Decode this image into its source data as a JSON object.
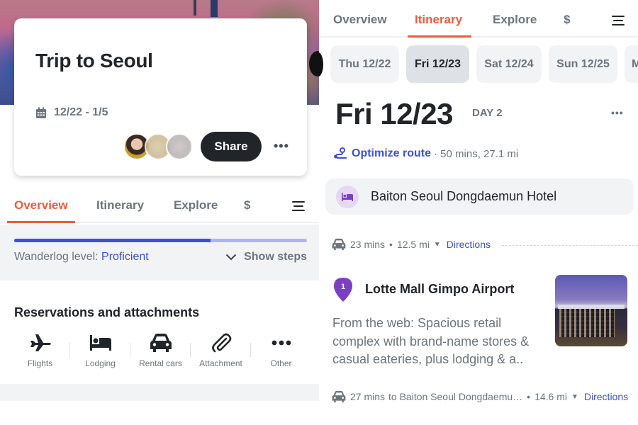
{
  "colors": {
    "accent": "#f05a3c",
    "link": "#3d4fd6",
    "lodging_purple": "#7b3fc4",
    "dark": "#212529",
    "muted": "#6c757d"
  },
  "overview": {
    "trip": {
      "title": "Trip to Seoul",
      "dates": "12/22 - 1/5",
      "calendar_icon": "calendar-icon",
      "avatars": [
        "avatar-1",
        "avatar-2",
        "avatar-3"
      ],
      "share_label": "Share",
      "more_label": "•••"
    },
    "tabs": [
      {
        "label": "Overview",
        "active": true
      },
      {
        "label": "Itinerary",
        "active": false
      },
      {
        "label": "Explore",
        "active": false
      },
      {
        "label": "$",
        "active": false
      }
    ],
    "menu_icon": "hamburger-icon",
    "level": {
      "progress_percent": 67,
      "label": "Wanderlog level: ",
      "value": "Proficient",
      "show_steps_label": "Show steps"
    },
    "reservations": {
      "title": "Reservations and attachments",
      "items": [
        {
          "label": "Flights",
          "icon": "airplane-icon"
        },
        {
          "label": "Lodging",
          "icon": "bed-icon"
        },
        {
          "label": "Rental cars",
          "icon": "car-icon"
        },
        {
          "label": "Attachment",
          "icon": "paperclip-icon"
        },
        {
          "label": "Other",
          "icon": "more-icon"
        }
      ]
    }
  },
  "itinerary": {
    "tabs": [
      {
        "label": "Overview",
        "active": false
      },
      {
        "label": "Itinerary",
        "active": true
      },
      {
        "label": "Explore",
        "active": false
      },
      {
        "label": "$",
        "active": false
      }
    ],
    "day_chips": [
      {
        "label": "Thu 12/22",
        "active": false
      },
      {
        "label": "Fri 12/23",
        "active": true
      },
      {
        "label": "Sat 12/24",
        "active": false
      },
      {
        "label": "Sun 12/25",
        "active": false
      },
      {
        "label": "M",
        "active": false
      }
    ],
    "day": {
      "title": "Fri 12/23",
      "label": "DAY 2",
      "more_label": "•••"
    },
    "optimize": {
      "link_label": "Optimize route",
      "meta": "· 50 mins, 27.1 mi"
    },
    "lodging": {
      "name": "Baiton Seoul Dongdaemun Hotel"
    },
    "directions_1": {
      "duration": "23 mins",
      "dot": "•",
      "distance": "12.5 mi",
      "link": "Directions"
    },
    "place": {
      "number": "1",
      "name": "Lotte Mall Gimpo Airport",
      "description": "From the web: Spacious retail complex with brand-name stores & casual eateries, plus lodging & a.."
    },
    "directions_2": {
      "duration": "27 mins",
      "destination": "to Baiton Seoul Dongdaemu…",
      "dot": "•",
      "distance": "14.6 mi",
      "link": "Directions"
    }
  }
}
